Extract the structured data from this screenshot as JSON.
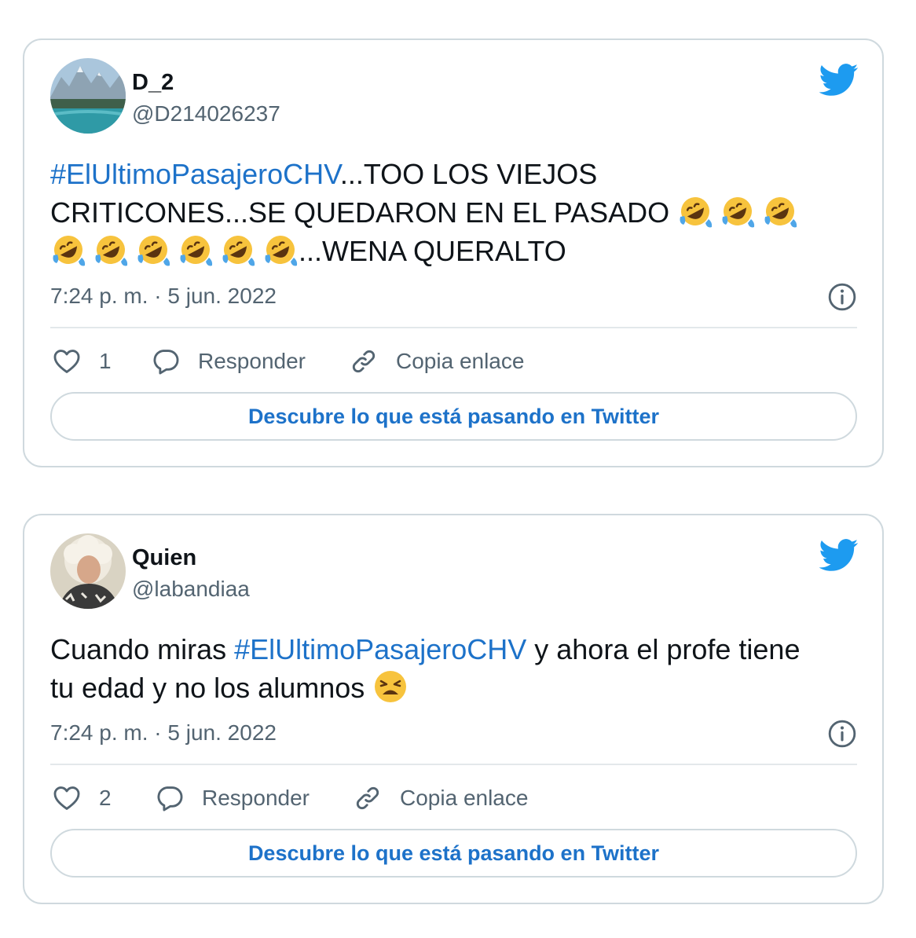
{
  "tweets": [
    {
      "author_name": "D_2",
      "author_handle": "@D214026237",
      "hashtag": "#ElUltimoPasajeroCHV",
      "text_after_hashtag_line1": "...TOO LOS VIEJOS",
      "text_line2": "CRITICONES...SE QUEDARON EN EL PASADO",
      "text_end": "...WENA QUERALTO",
      "emoji_name": "rolling-on-the-floor-laughing",
      "timestamp": "7:24 p. m. · 5 jun. 2022",
      "likes": "1",
      "reply_label": "Responder",
      "copy_link_label": "Copia enlace",
      "cta_label": "Descubre lo que está pasando en Twitter"
    },
    {
      "author_name": "Quien",
      "author_handle": "@labandiaa",
      "text_before_hashtag": "Cuando miras ",
      "hashtag": "#ElUltimoPasajeroCHV",
      "text_after_hashtag": " y ahora el profe tiene",
      "text_line2": "tu edad y no los alumnos ",
      "emoji_name": "weary-face",
      "timestamp": "7:24 p. m. · 5 jun. 2022",
      "likes": "2",
      "reply_label": "Responder",
      "copy_link_label": "Copia enlace",
      "cta_label": "Descubre lo que está pasando en Twitter"
    }
  ],
  "colors": {
    "link_blue": "#1d72c9",
    "twitter_bird": "#1d9bf0",
    "muted_text": "#536471",
    "border": "#cfd9de"
  },
  "icons": [
    "twitter-bird-icon",
    "info-icon",
    "heart-icon",
    "reply-bubble-icon",
    "link-icon"
  ]
}
